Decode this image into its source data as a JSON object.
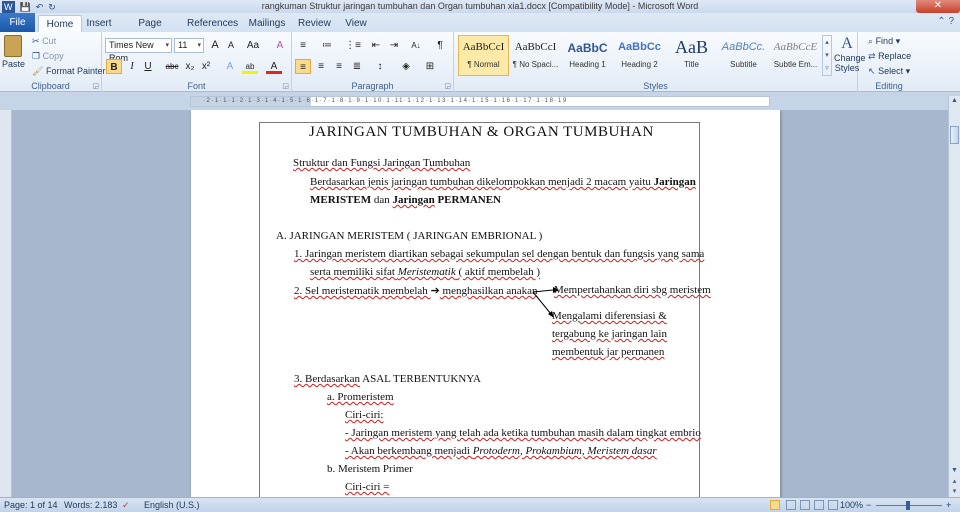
{
  "window": {
    "title": "rangkuman Struktur jaringan tumbuhan dan Organ tumbuhan xia1.docx [Compatibility Mode]  -  Microsoft Word",
    "close_glyph": "✕"
  },
  "quick_access": {
    "word_icon": "W",
    "save_icon": "💾",
    "undo_icon": "↶",
    "redo_icon": "↻"
  },
  "tabs": [
    "File",
    "Home",
    "Insert",
    "Page Layout",
    "References",
    "Mailings",
    "Review",
    "View"
  ],
  "help": "⌃ ?",
  "clipboard": {
    "paste": "Paste",
    "cut": "Cut",
    "copy": "Copy",
    "format_painter": "Format Painter",
    "label": "Clipboard"
  },
  "font": {
    "name": "Times New Rom",
    "size": "11",
    "grow": "A",
    "shrink": "A",
    "case": "Aa",
    "clear": "A",
    "bold": "B",
    "italic": "I",
    "underline": "U",
    "strike": "abc",
    "subscript": "x₂",
    "superscript": "x²",
    "effects": "A",
    "highlight": "ab",
    "color": "A",
    "label": "Font"
  },
  "paragraph": {
    "bullets": "≡",
    "numbering": "≔",
    "multilevel": "⋮≡",
    "decrease_indent": "⇤",
    "increase_indent": "⇥",
    "sort": "A↓",
    "pilcrow": "¶",
    "label": "Paragraph"
  },
  "styles": {
    "items": [
      {
        "preview": "AaBbCcI",
        "name": "¶ Normal"
      },
      {
        "preview": "AaBbCcI",
        "name": "¶ No Spaci..."
      },
      {
        "preview": "AaBbC",
        "name": "Heading 1"
      },
      {
        "preview": "AaBbCc",
        "name": "Heading 2"
      },
      {
        "preview": "AaB",
        "name": "Title"
      },
      {
        "preview": "AaBbCc.",
        "name": "Subtitle"
      },
      {
        "preview": "AaBbCcE",
        "name": "Subtle Em..."
      }
    ],
    "change": "Change\nStyles",
    "label": "Styles"
  },
  "editing": {
    "find": "Find",
    "replace": "Replace",
    "select": "Select",
    "label": "Editing"
  },
  "ruler": "·2·1·1·1·2·1·3·1·4·1·5·1·6·1·7·1·8·1·9·1·10·1·11·1·12·1·13·1·14·1·15·1·16·1·17·1·18·19",
  "document": {
    "heading": "JARINGAN TUMBUHAN & ORGAN TUMBUHAN",
    "subheading": "Struktur dan Fungsi Jaringan Tumbuhan",
    "intro1_a": "Berdasarkan jenis jaringan tumbuhan dikelompokkan menjadi 2 macam yaitu ",
    "intro1_b": "Jaringan",
    "intro2_a": "MERISTEM",
    "intro2_b": " dan ",
    "intro2_c": "Jaringan",
    "intro2_d": " PERMANEN",
    "sectionA": "A.   JARINGAN MERISTEM   ( JARINGAN EMBRIONAL )",
    "item1_line1": "1.    Jaringan meristem diartikan sebagai sekumpulan sel dengan bentuk dan fungsis yang sama",
    "item1_line2_a": "serta memiliki sifat ",
    "item1_line2_b": "Meristematik",
    "item1_line2_c": " ( aktif membelah )",
    "item2_a": "2.    Sel meristematik membelah ",
    "item2_arrow": "➔",
    "item2_b": " menghasilkan anakan",
    "branch1": "Mempertahankan diri sbg meristem",
    "branch2_1": "Mengalami diferensiasi &",
    "branch2_2": "tergabung ke jaringan lain",
    "branch2_3": "membentuk jar permanen",
    "item3_a": "3.    Berdasarkan",
    "item3_b": " ASAL TERBENTUKNYA",
    "a_label": "a.     Promeristem",
    "ciri1": "Ciri-ciri:",
    "dash1": "-      Jaringan meristem yang telah ada ketika tumbuhan masih dalam tingkat embrio",
    "dash2_a": "-      Akan berkembang menjadi ",
    "dash2_b": "Protoderm, Prokambium, Meristem dasar",
    "b_label": "b.     Meristem Primer",
    "ciri2": "Ciri-ciri ="
  },
  "statusbar": {
    "page": "Page: 1 of 14",
    "words": "Words: 2.183",
    "lang": "English (U.S.)",
    "zoom": "100%",
    "minus": "−",
    "plus": "+"
  }
}
